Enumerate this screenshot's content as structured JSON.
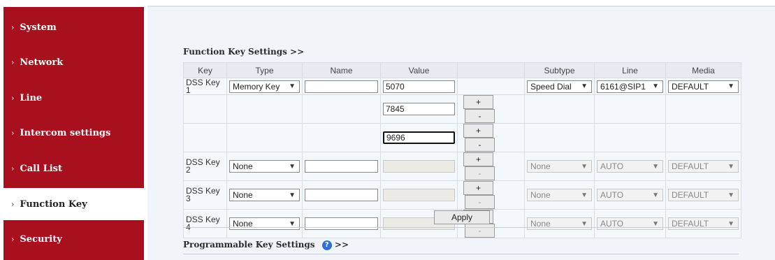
{
  "sidebar": {
    "items": [
      {
        "label": "System"
      },
      {
        "label": "Network"
      },
      {
        "label": "Line"
      },
      {
        "label": "Intercom settings"
      },
      {
        "label": "Call List"
      },
      {
        "label": "Function Key",
        "active": true
      },
      {
        "label": "Security"
      }
    ],
    "chevron": "›"
  },
  "function_keys": {
    "title": "Function Key Settings >>",
    "headers": {
      "key": "Key",
      "type": "Type",
      "name": "Name",
      "value": "Value",
      "subtype": "Subtype",
      "line": "Line",
      "media": "Media"
    },
    "dss1": {
      "key": "DSS Key 1",
      "type": "Memory Key",
      "name": "",
      "value": "5070",
      "extra_values": [
        "7845",
        "9696"
      ],
      "subtype": "Speed Dial",
      "line": "6161@SIP1",
      "media": "DEFAULT"
    },
    "dss2": {
      "key": "DSS Key 2",
      "type": "None",
      "name": "",
      "value": "",
      "subtype": "None",
      "line": "AUTO",
      "media": "DEFAULT"
    },
    "dss3": {
      "key": "DSS Key 3",
      "type": "None",
      "name": "",
      "value": "",
      "subtype": "None",
      "line": "AUTO",
      "media": "DEFAULT"
    },
    "dss4": {
      "key": "DSS Key 4",
      "type": "None",
      "name": "",
      "value": "",
      "subtype": "None",
      "line": "AUTO",
      "media": "DEFAULT"
    },
    "plus": "+",
    "minus": "-",
    "apply": "Apply"
  },
  "programmable": {
    "title": "Programmable Key Settings",
    "suffix": ">>",
    "help_icon": "question-circle-icon"
  },
  "colors": {
    "sidebar_bg": "#a8101e",
    "main_bg": "#f1f5fa",
    "help_icon": "#2f6fd6"
  }
}
